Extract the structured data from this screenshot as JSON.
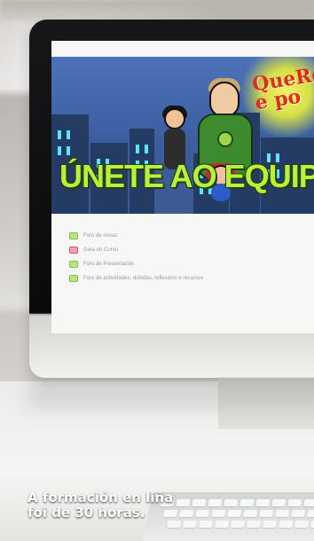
{
  "screen": {
    "banner": {
      "logo_text": "QueRe\ne po",
      "headline": "ÚNETE AO EQUIP"
    },
    "list": [
      {
        "label": "Foro de novas",
        "icon": "forum-icon"
      },
      {
        "label": "Guía do Curso",
        "icon": "guide-icon"
      },
      {
        "label": "Foro de Presentación",
        "icon": "forum-icon"
      },
      {
        "label": "Foro de actividades, dúbidas, reflexións e recursos",
        "icon": "forum-icon"
      }
    ]
  },
  "caption": {
    "line_1": "A formación en liña",
    "line_2": "foi de 30 horas."
  },
  "colors": {
    "banner_headline": "#b7f23a",
    "logo_text": "#de2c21",
    "monitor_bezel": "#111111"
  }
}
